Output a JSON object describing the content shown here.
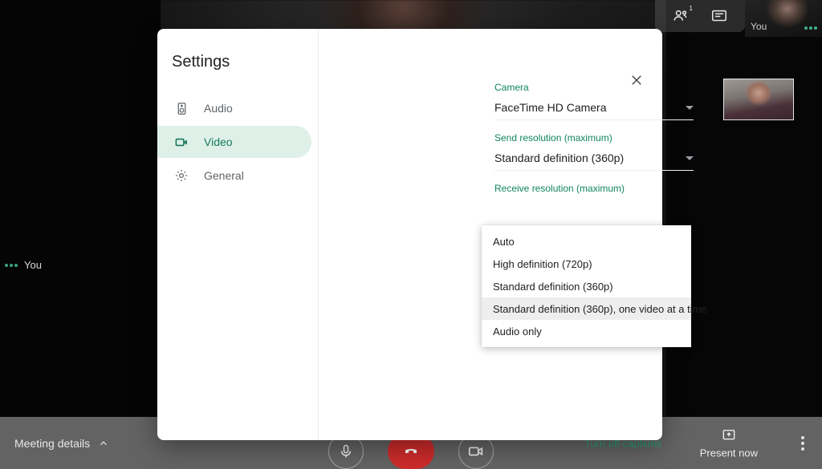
{
  "meeting": {
    "self_label": "You",
    "self_tile_label": "You",
    "participants_badge": "1",
    "people_icon": "people-icon",
    "chat_icon": "chat-icon",
    "mic_status_icon": "mic-activity-dots-icon"
  },
  "toolbar": {
    "meeting_details": "Meeting details",
    "meeting_details_chevron": "chevron-up-icon",
    "mic_icon": "microphone-icon",
    "hangup_icon": "end-call-icon",
    "camera_icon": "video-camera-icon",
    "captions_label": "Turn off captions",
    "present_label": "Present now",
    "present_icon": "present-screen-icon",
    "more_icon": "more-vertical-icon"
  },
  "modal": {
    "title": "Settings",
    "close_icon": "close-icon",
    "nav": [
      {
        "label": "Audio",
        "icon": "speaker-icon",
        "active": false
      },
      {
        "label": "Video",
        "icon": "video-camera-icon",
        "active": true
      },
      {
        "label": "General",
        "icon": "gear-icon",
        "active": false
      }
    ],
    "fields": [
      {
        "label": "Camera",
        "value": "FaceTime HD Camera"
      },
      {
        "label": "Send resolution (maximum)",
        "value": "Standard definition (360p)"
      },
      {
        "label": "Receive resolution (maximum)",
        "value": "Standard definition (360p), one video at a time"
      }
    ],
    "camera_preview_alt": "camera-preview",
    "dropdown": {
      "open": true,
      "for_field": "Receive resolution (maximum)",
      "options": [
        {
          "label": "Auto",
          "highlighted": false
        },
        {
          "label": "High definition (720p)",
          "highlighted": false
        },
        {
          "label": "Standard definition (360p)",
          "highlighted": false
        },
        {
          "label": "Standard definition (360p), one video at a time",
          "highlighted": true
        },
        {
          "label": "Audio only",
          "highlighted": false
        }
      ]
    }
  },
  "colors": {
    "accent_green": "#11855f",
    "nav_active_bg": "#dff0e9",
    "nav_active_fg": "#177a5a",
    "toolbar_bg": "#636363",
    "hangup_red": "#cc2b2b",
    "highlight_bg": "#eeeeee"
  }
}
